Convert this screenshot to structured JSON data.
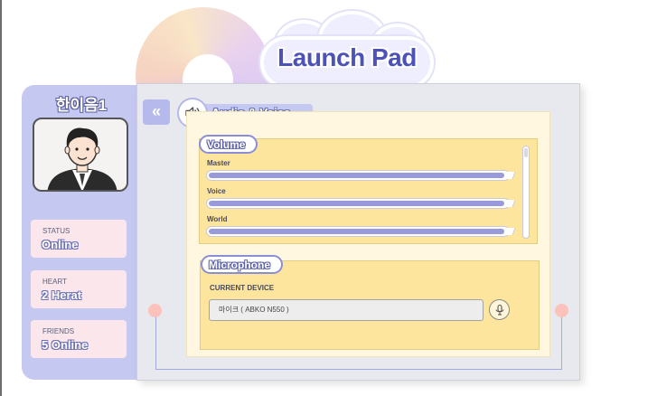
{
  "app": {
    "title": "Launch Pad"
  },
  "profile": {
    "name": "한이음1",
    "avatar_icon": "person-avatar",
    "stats": [
      {
        "label": "STATUS",
        "value": "Online"
      },
      {
        "label": "HEART",
        "value": "2 Herat"
      },
      {
        "label": "FRIENDS",
        "value": "5 Online"
      }
    ]
  },
  "nav": {
    "back_icon": "double-chevron-left-icon",
    "back_glyph": "«",
    "section_title": "Audio & Voice",
    "section_icon": "speaker-icon"
  },
  "volume": {
    "title": "Volume",
    "sliders": [
      {
        "label": "Master",
        "level": 0.99
      },
      {
        "label": "Voice",
        "level": 0.99
      },
      {
        "label": "World",
        "level": 0.99
      }
    ]
  },
  "microphone": {
    "title": "Microphone",
    "device_label": "CURRENT DEVICE",
    "device_value": "마이크 ( ABKO N550 )",
    "mic_icon": "microphone-icon"
  },
  "colors": {
    "accent": "#c5c8f0",
    "slider_fill": "#989ad9",
    "group_bg": "#fde59e",
    "card_bg": "#fbe6ec",
    "dot": "#fbc2bb"
  }
}
